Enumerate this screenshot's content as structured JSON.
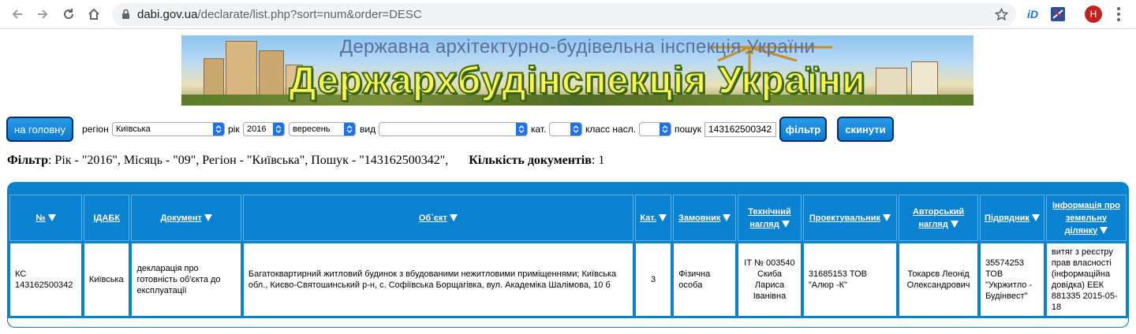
{
  "browser": {
    "url_host": "dabi.gov.ua",
    "url_path": "/declarate/list.php?sort=num&order=DESC",
    "avatar_letter": "H"
  },
  "header": {
    "line1": "Державна архітектурно-будівельна інспекція України",
    "line2": "Держархбудінспекція України"
  },
  "filters": {
    "home_button": "на головну",
    "region_label": "регіон",
    "region_value": "Київська",
    "year_label": "рік",
    "year_value": "2016",
    "month_value": "вересень",
    "type_label": "вид",
    "type_value": "",
    "cat_label": "кат.",
    "cat_value": "",
    "class_label": "класс насл.",
    "class_value": "",
    "search_label": "пошук",
    "search_value": "143162500342",
    "filter_button": "фільтр",
    "reset_button": "скинути"
  },
  "summary": {
    "filter_label": "Фільтр",
    "filter_text": ": Рік - \"2016\", Місяць - \"09\", Регіон - \"Київська\", Пошук - \"143162500342\",",
    "count_label": "Кількість документів",
    "count_value": ": 1"
  },
  "table": {
    "headers": {
      "num": "№",
      "idabk": "ІДАБК",
      "document": "Документ",
      "object": "Об`єкт",
      "cat": "Кат.",
      "customer": "Замовник",
      "tech1": "Технічний",
      "tech2": "нагляд",
      "designer": "Проектувальник",
      "author1": "Авторський",
      "author2": "нагляд",
      "contractor": "Підрядник",
      "land1": "Інформація про",
      "land2": "земельну",
      "land3": "ділянку"
    },
    "rows": [
      {
        "num": "КС 143162500342",
        "idabk": "Київська",
        "document": "декларація про готовність об'єкта до експлуатації",
        "object": "Багатоквартирний житловий будинок з вбудованими нежитловими приміщеннями; Київська обл., Києво-Святошинський р-н, с. Софіївська Борщагівка, вул. Академіка Шалімова, 10 б",
        "cat": "3",
        "customer": "Фізична особа",
        "tech": "ІТ № 003540 Скиба Лариса Іванівна",
        "designer": "31685153 ТОВ \"Алюр -К\"",
        "author": "Токарєв Леонід Олександрович",
        "contractor": "35574253 ТОВ \"Укржитло - Будінвест\"",
        "land": "витяг з реєстру прав власності (інформаційна довідка) ЕЕК 881335 2015-05-18"
      }
    ]
  },
  "colors": {
    "table_blue": "#0a82d0",
    "button_border": "#0a2a66",
    "banner_text": "#fff44f"
  }
}
